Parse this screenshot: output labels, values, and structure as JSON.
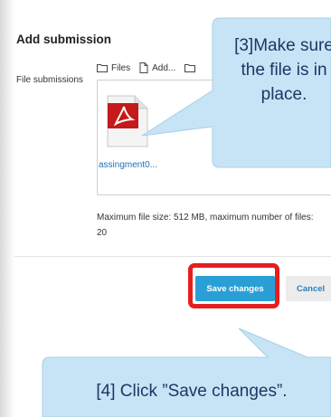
{
  "form": {
    "heading": "Add submission",
    "field_label": "File submissions",
    "toolbar": {
      "files_label": "Files",
      "add_label": "Add...",
      "third_label": ""
    },
    "file": {
      "name": "assingment0...",
      "icon": "pdf-file-icon"
    },
    "max_info": "Maximum file size: 512 MB, maximum number of files: 20",
    "save_label": "Save changes",
    "cancel_label": "Cancel"
  },
  "callouts": {
    "step3": "[3]Make sure the file is in place.",
    "step4": "[4] Click ”Save changes”."
  },
  "colors": {
    "primary_button": "#2a9fd6",
    "highlight": "#e61e1e",
    "callout_fill": "#c6e4f5",
    "callout_text": "#1a3864",
    "link": "#1f6fb5"
  }
}
